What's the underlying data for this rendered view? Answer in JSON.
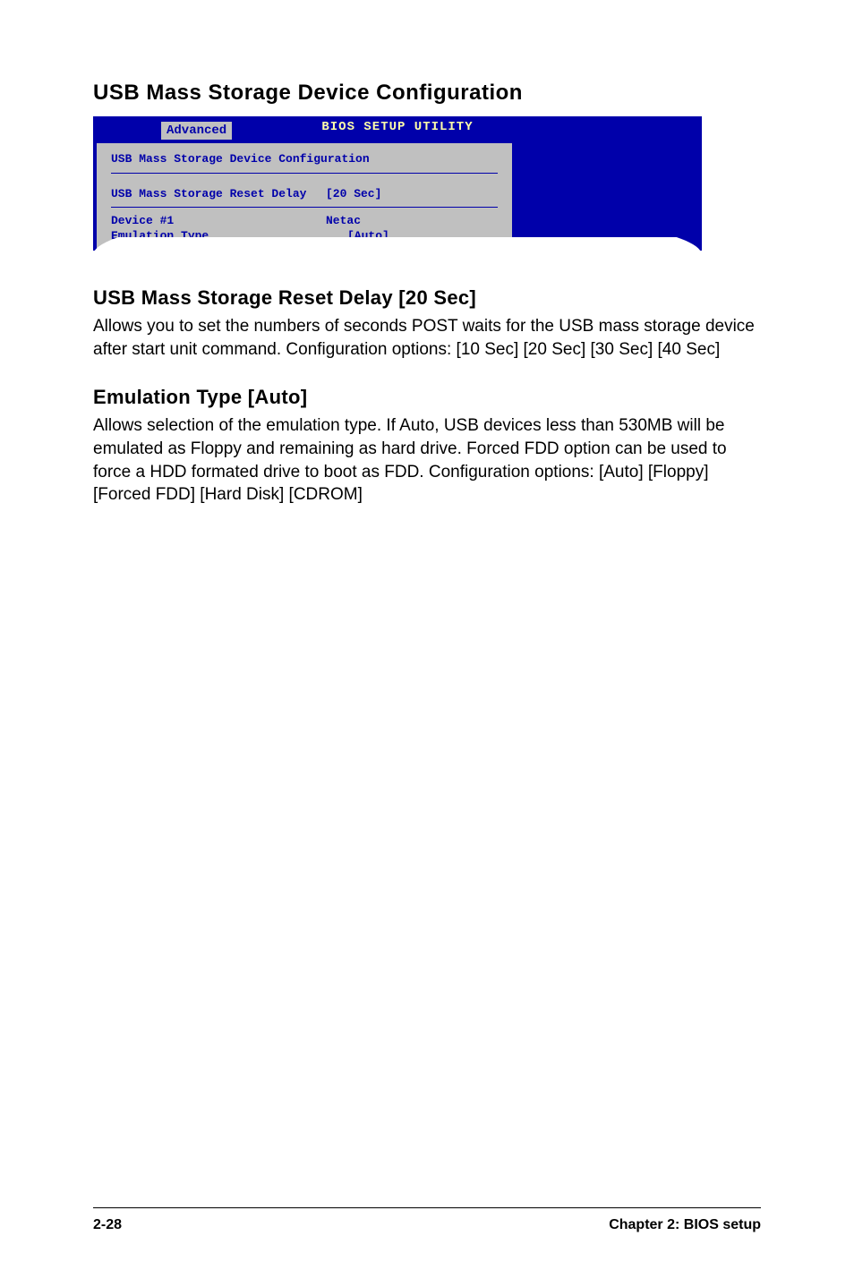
{
  "heading_main": "USB Mass Storage Device Configuration",
  "bios": {
    "utility_title": "BIOS SETUP UTILITY",
    "tab_label": "Advanced",
    "panel_title": "USB Mass Storage Device Configuration",
    "row1_label": "USB Mass Storage Reset Delay",
    "row1_value": "[20 Sec]",
    "row2_label": "Device #1",
    "row2_value": "Netac",
    "row3_label": "Emulation Type",
    "row3_value": "[Auto]"
  },
  "sections": {
    "reset_delay": {
      "heading": "USB Mass Storage Reset Delay [20 Sec]",
      "body": "Allows you to set the numbers of seconds POST waits for the USB mass storage device after start unit command. Configuration options: [10 Sec] [20 Sec] [30 Sec] [40 Sec]"
    },
    "emulation": {
      "heading": "Emulation Type [Auto]",
      "body": "Allows selection of the emulation type. If Auto, USB devices less than 530MB will be emulated as Floppy and remaining as hard drive. Forced FDD option can be used to force a HDD formated drive to boot as FDD. Configuration options: [Auto] [Floppy] [Forced FDD] [Hard Disk] [CDROM]"
    }
  },
  "footer": {
    "page_number": "2-28",
    "chapter": "Chapter 2: BIOS setup"
  }
}
